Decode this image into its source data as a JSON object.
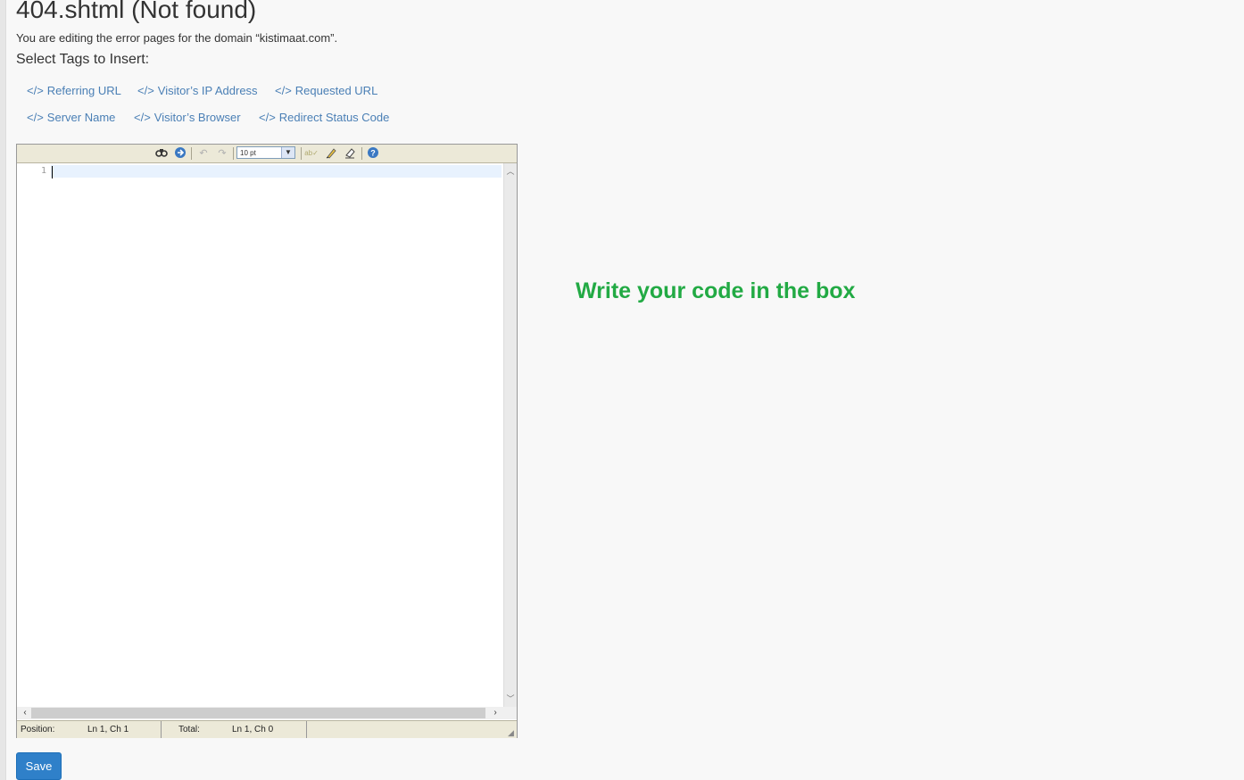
{
  "page": {
    "title": "404.shtml (Not found)",
    "description": "You are editing the error pages for the domain “kistimaat.com”.",
    "tags_heading": "Select Tags to Insert:"
  },
  "tags": [
    {
      "label": "Referring URL",
      "icon": "code-icon"
    },
    {
      "label": "Visitor’s IP Address",
      "icon": "code-icon"
    },
    {
      "label": "Requested URL",
      "icon": "code-icon"
    },
    {
      "label": "Server Name",
      "icon": "code-icon"
    },
    {
      "label": "Visitor’s Browser",
      "icon": "code-icon"
    },
    {
      "label": "Redirect Status Code",
      "icon": "code-icon"
    }
  ],
  "tag_icon_glyph": "</>",
  "editor": {
    "toolbar": {
      "font_size": "10 pt",
      "buttons": [
        "search-icon",
        "goto-line-icon",
        "undo-icon",
        "redo-icon",
        "spellcheck-icon",
        "highlight-icon",
        "reset-icon",
        "help-icon"
      ]
    },
    "line_number": "1",
    "status": {
      "position_label": "Position:",
      "position_value": "Ln 1, Ch 1",
      "total_label": "Total:",
      "total_value": "Ln 1, Ch 0"
    }
  },
  "annotation": {
    "text": "Write your code in the box",
    "color": "#22aa44"
  },
  "actions": {
    "save_label": "Save"
  },
  "colors": {
    "link": "#4a7fb5",
    "primary_button": "#2f80c9"
  }
}
